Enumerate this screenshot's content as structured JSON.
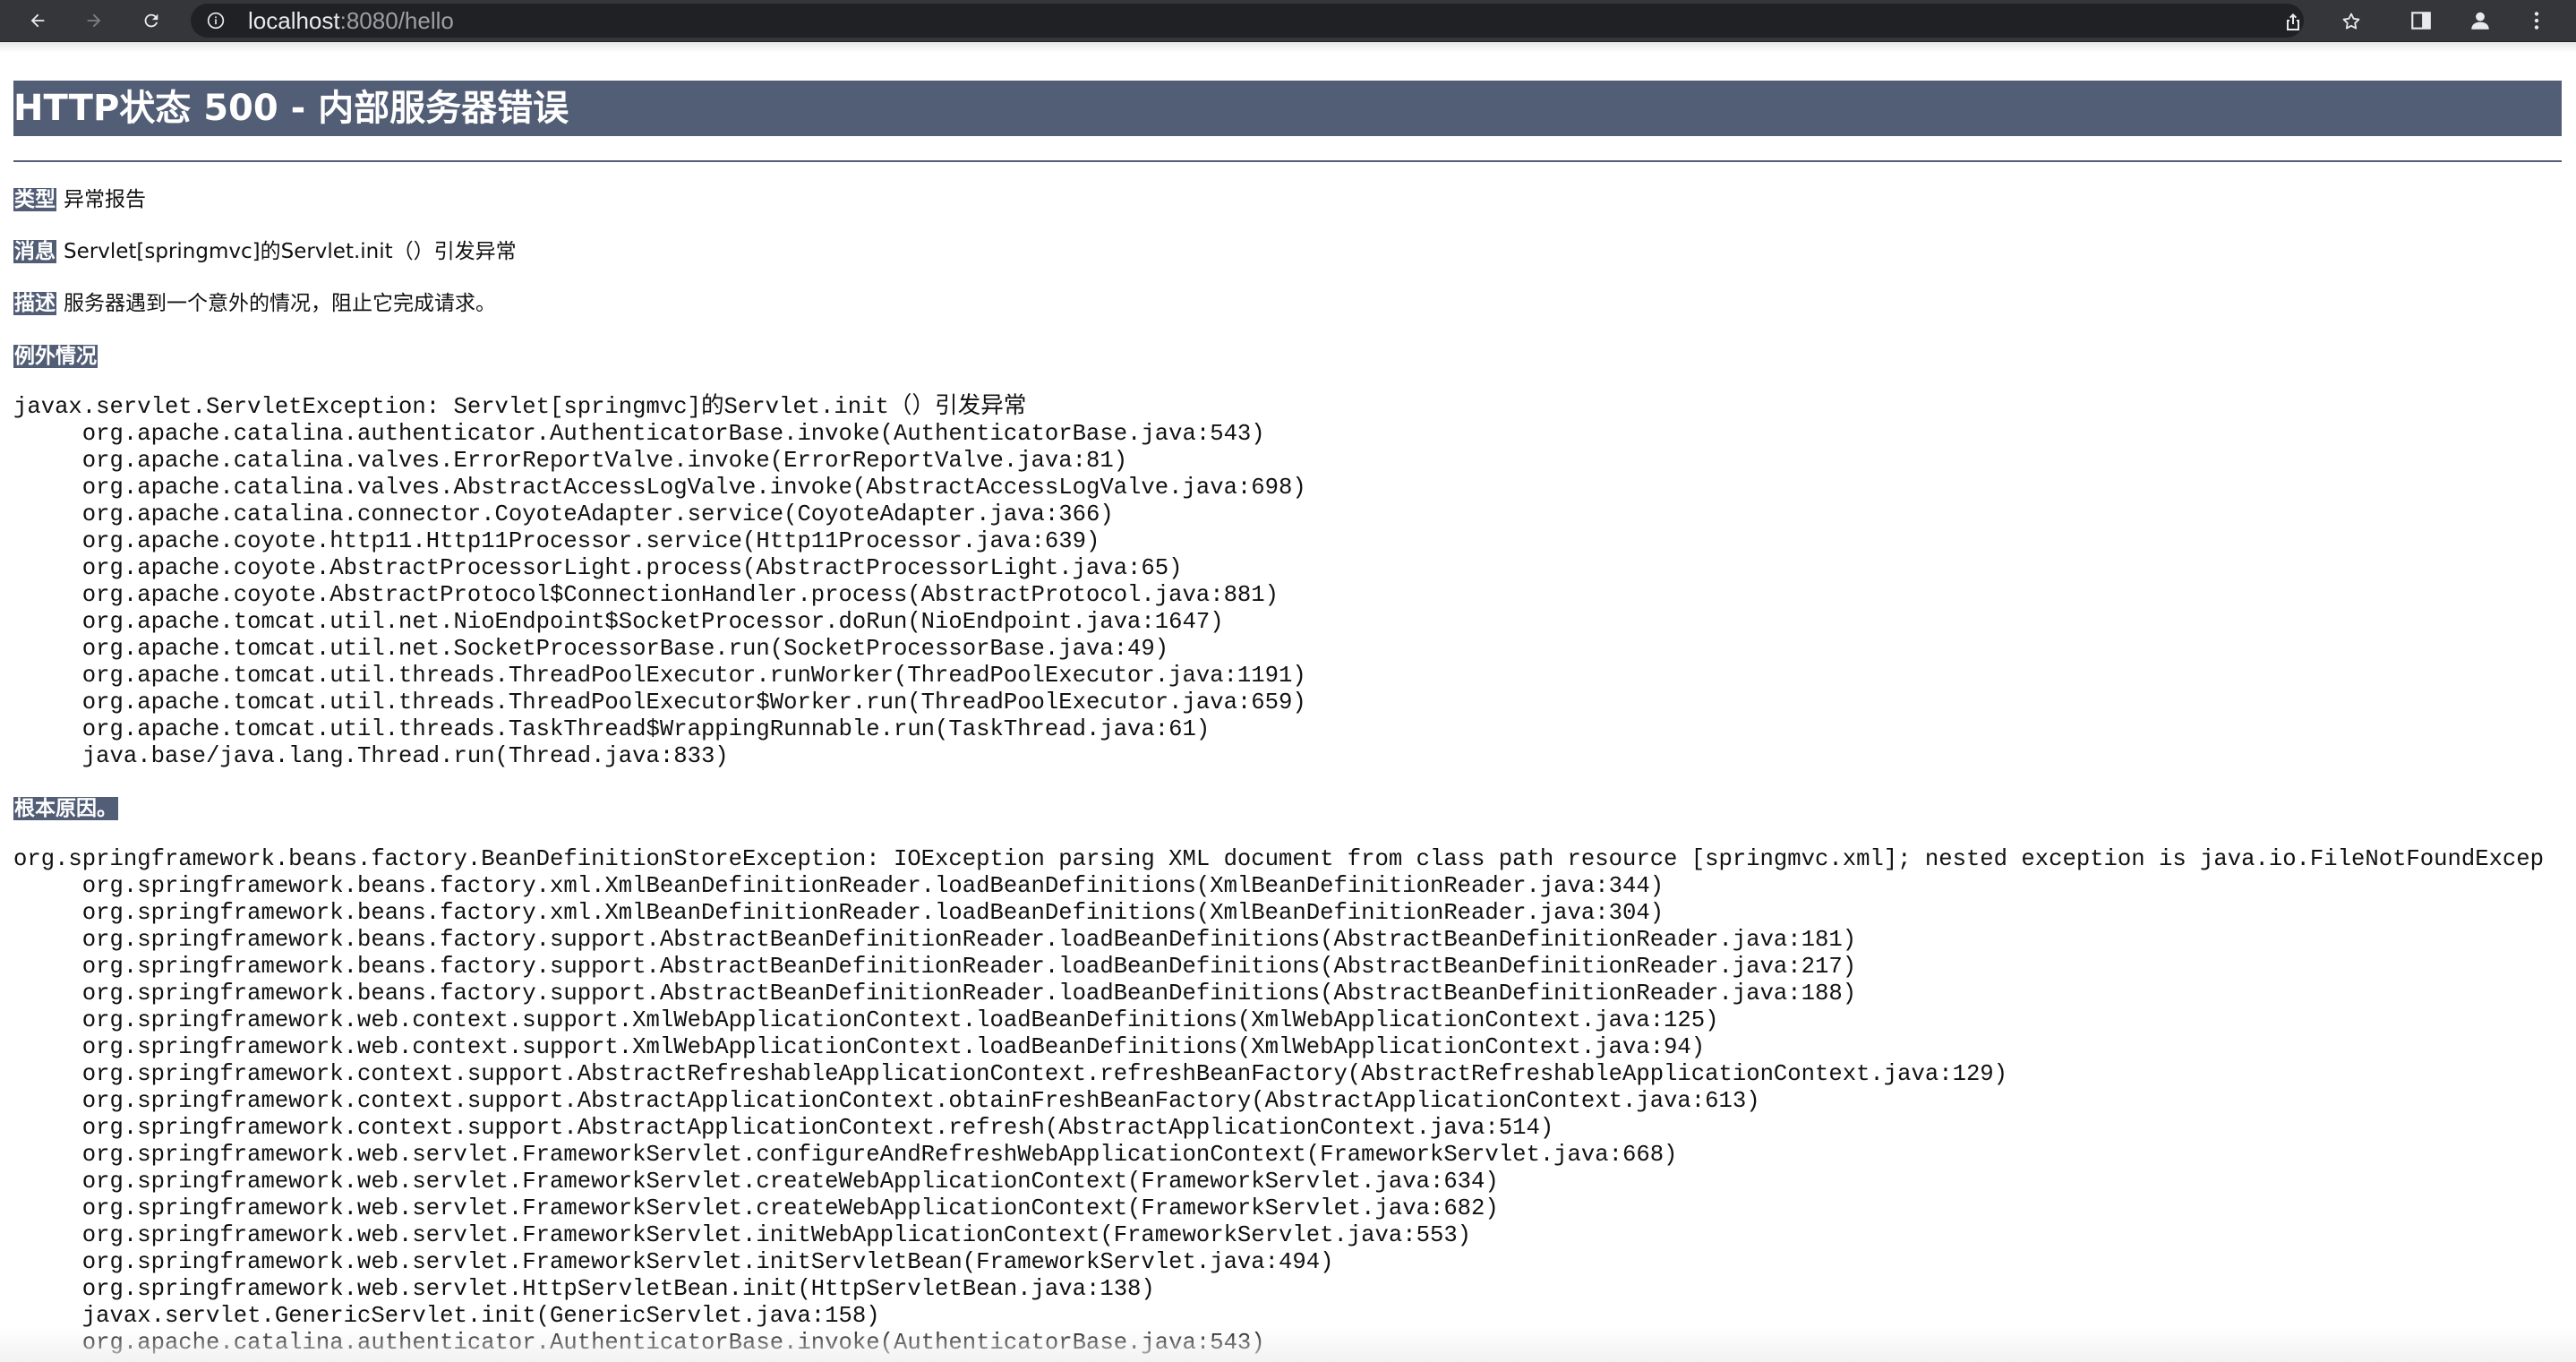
{
  "browser": {
    "url_host": "localhost",
    "url_path": ":8080/hello"
  },
  "page": {
    "title": "HTTP状态 500 - 内部服务器错误",
    "type_label": "类型",
    "type_value": "异常报告",
    "message_label": "消息",
    "message_value": "Servlet[springmvc]的Servlet.init（）引发异常",
    "description_label": "描述",
    "description_value": "服务器遇到一个意外的情况，阻止它完成请求。",
    "exception_label": "例外情况",
    "exception_trace": "javax.servlet.ServletException: Servlet[springmvc]的Servlet.init（）引发异常\n\torg.apache.catalina.authenticator.AuthenticatorBase.invoke(AuthenticatorBase.java:543)\n\torg.apache.catalina.valves.ErrorReportValve.invoke(ErrorReportValve.java:81)\n\torg.apache.catalina.valves.AbstractAccessLogValve.invoke(AbstractAccessLogValve.java:698)\n\torg.apache.catalina.connector.CoyoteAdapter.service(CoyoteAdapter.java:366)\n\torg.apache.coyote.http11.Http11Processor.service(Http11Processor.java:639)\n\torg.apache.coyote.AbstractProcessorLight.process(AbstractProcessorLight.java:65)\n\torg.apache.coyote.AbstractProtocol$ConnectionHandler.process(AbstractProtocol.java:881)\n\torg.apache.tomcat.util.net.NioEndpoint$SocketProcessor.doRun(NioEndpoint.java:1647)\n\torg.apache.tomcat.util.net.SocketProcessorBase.run(SocketProcessorBase.java:49)\n\torg.apache.tomcat.util.threads.ThreadPoolExecutor.runWorker(ThreadPoolExecutor.java:1191)\n\torg.apache.tomcat.util.threads.ThreadPoolExecutor$Worker.run(ThreadPoolExecutor.java:659)\n\torg.apache.tomcat.util.threads.TaskThread$WrappingRunnable.run(TaskThread.java:61)\n\tjava.base/java.lang.Thread.run(Thread.java:833)",
    "root_cause_label": "根本原因。",
    "root_cause_trace": "org.springframework.beans.factory.BeanDefinitionStoreException: IOException parsing XML document from class path resource [springmvc.xml]; nested exception is java.io.FileNotFoundExcep\n\torg.springframework.beans.factory.xml.XmlBeanDefinitionReader.loadBeanDefinitions(XmlBeanDefinitionReader.java:344)\n\torg.springframework.beans.factory.xml.XmlBeanDefinitionReader.loadBeanDefinitions(XmlBeanDefinitionReader.java:304)\n\torg.springframework.beans.factory.support.AbstractBeanDefinitionReader.loadBeanDefinitions(AbstractBeanDefinitionReader.java:181)\n\torg.springframework.beans.factory.support.AbstractBeanDefinitionReader.loadBeanDefinitions(AbstractBeanDefinitionReader.java:217)\n\torg.springframework.beans.factory.support.AbstractBeanDefinitionReader.loadBeanDefinitions(AbstractBeanDefinitionReader.java:188)\n\torg.springframework.web.context.support.XmlWebApplicationContext.loadBeanDefinitions(XmlWebApplicationContext.java:125)\n\torg.springframework.web.context.support.XmlWebApplicationContext.loadBeanDefinitions(XmlWebApplicationContext.java:94)\n\torg.springframework.context.support.AbstractRefreshableApplicationContext.refreshBeanFactory(AbstractRefreshableApplicationContext.java:129)\n\torg.springframework.context.support.AbstractApplicationContext.obtainFreshBeanFactory(AbstractApplicationContext.java:613)\n\torg.springframework.context.support.AbstractApplicationContext.refresh(AbstractApplicationContext.java:514)\n\torg.springframework.web.servlet.FrameworkServlet.configureAndRefreshWebApplicationContext(FrameworkServlet.java:668)\n\torg.springframework.web.servlet.FrameworkServlet.createWebApplicationContext(FrameworkServlet.java:634)\n\torg.springframework.web.servlet.FrameworkServlet.createWebApplicationContext(FrameworkServlet.java:682)\n\torg.springframework.web.servlet.FrameworkServlet.initWebApplicationContext(FrameworkServlet.java:553)\n\torg.springframework.web.servlet.FrameworkServlet.initServletBean(FrameworkServlet.java:494)\n\torg.springframework.web.servlet.HttpServletBean.init(HttpServletBean.java:138)\n\tjavax.servlet.GenericServlet.init(GenericServlet.java:158)\n\torg.apache.catalina.authenticator.AuthenticatorBase.invoke(AuthenticatorBase.java:543)"
  },
  "colors": {
    "toolbar_bg": "#35363a",
    "omnibox_bg": "#202124",
    "label_bg": "#525d76"
  },
  "icons": [
    "back-icon",
    "forward-icon",
    "reload-icon",
    "info-icon",
    "share-icon",
    "bookmark-star-icon",
    "side-panel-icon",
    "profile-icon",
    "menu-kebab-icon"
  ]
}
